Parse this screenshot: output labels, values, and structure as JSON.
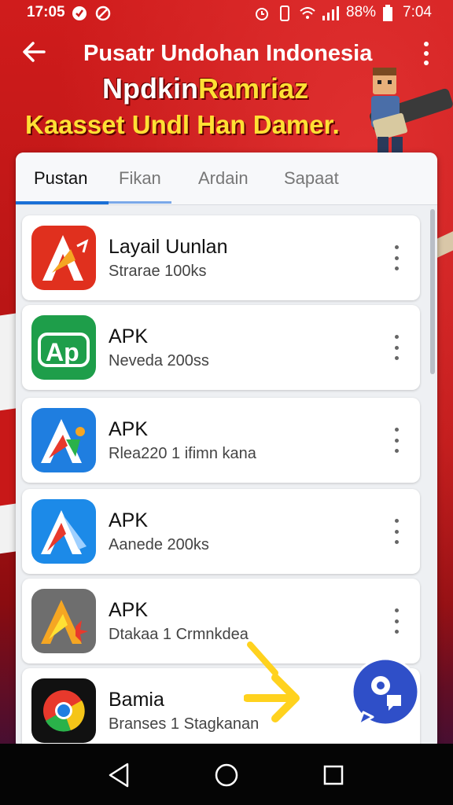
{
  "status_bar": {
    "time": "17:05",
    "battery": "88%",
    "clock": "7:04"
  },
  "header": {
    "title": "Pusatr Undohan Indonesia",
    "promo_line1_white": "Npdkin",
    "promo_line1_yellow": "Ramriaz",
    "promo_line2": "Kaasset Undl Han Damer."
  },
  "tabs": [
    {
      "label": "Pustan"
    },
    {
      "label": "Fikan"
    },
    {
      "label": "Ardain"
    },
    {
      "label": "Sapaat"
    }
  ],
  "apps": [
    {
      "name": "Layail Uunlan",
      "subtitle": "Strarae 100ks",
      "icon": "red-a-icon"
    },
    {
      "name": "APK",
      "subtitle": "Neveda 200ss",
      "icon": "green-ap-icon"
    },
    {
      "name": "APK",
      "subtitle": "Rlea220 1 ifimn kana",
      "icon": "blue-a-icon"
    },
    {
      "name": "APK",
      "subtitle": "Aanede 200ks",
      "icon": "blue-triangle-a-icon"
    },
    {
      "name": "APK",
      "subtitle": "Dtakaa 1 Crmnkdea",
      "icon": "gray-a-icon"
    },
    {
      "name": "Bamia",
      "subtitle": "Branses 1 Stagkanan",
      "icon": "chrome-icon"
    }
  ],
  "colors": {
    "accent": "#1a6fd6",
    "banner_red": "#c81818",
    "promo_yellow": "#ffe034",
    "fab_blue": "#2f4fc8"
  }
}
